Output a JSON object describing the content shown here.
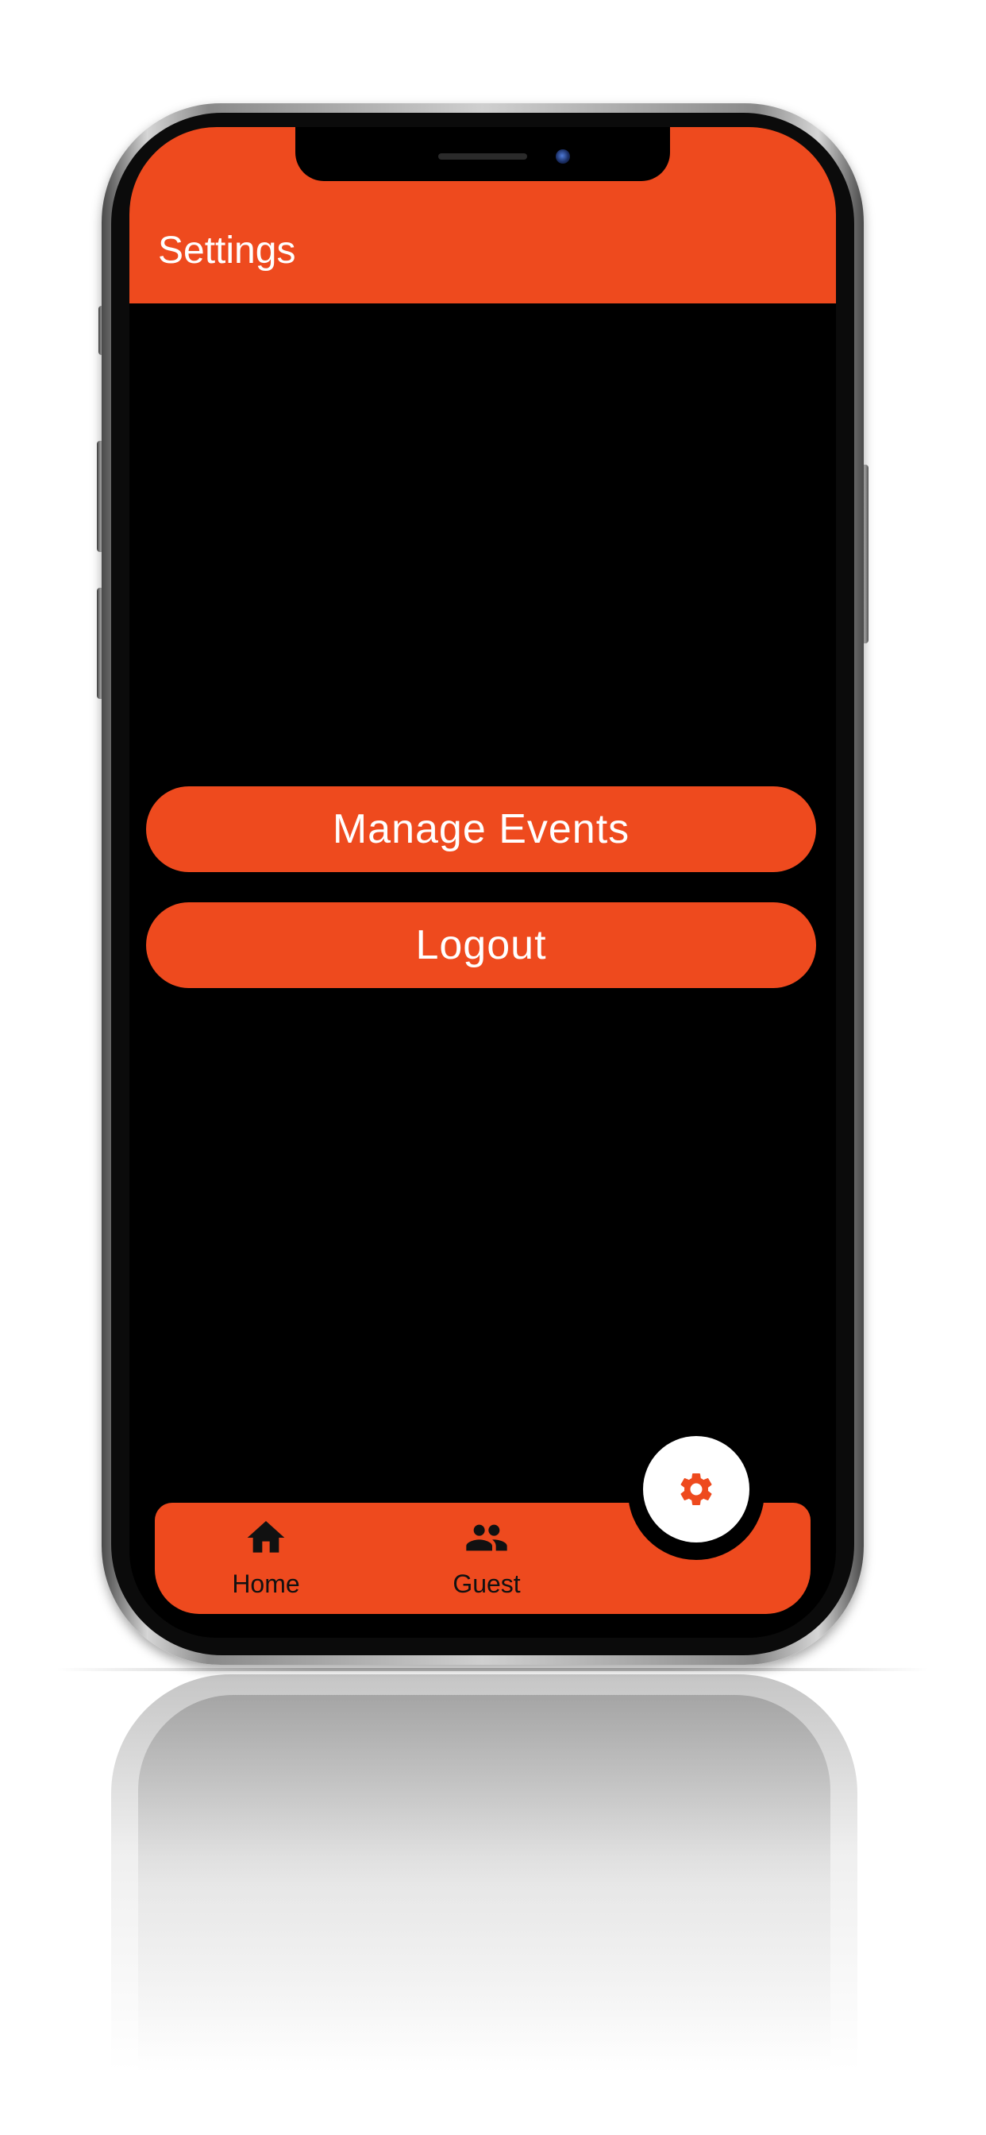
{
  "app_bar": {
    "title": "Settings"
  },
  "actions": {
    "manage_events_label": "Manage Events",
    "logout_label": "Logout"
  },
  "bottom_nav": {
    "items": [
      {
        "label": "Home",
        "icon": "home-icon"
      },
      {
        "label": "Guest",
        "icon": "people-icon"
      }
    ],
    "fab_icon": "gear-icon",
    "active": "settings"
  },
  "colors": {
    "accent": "#ee4a1e",
    "background": "#000000",
    "fab_background": "#ffffff",
    "text_on_accent": "#ffffff",
    "nav_text": "#111111"
  }
}
